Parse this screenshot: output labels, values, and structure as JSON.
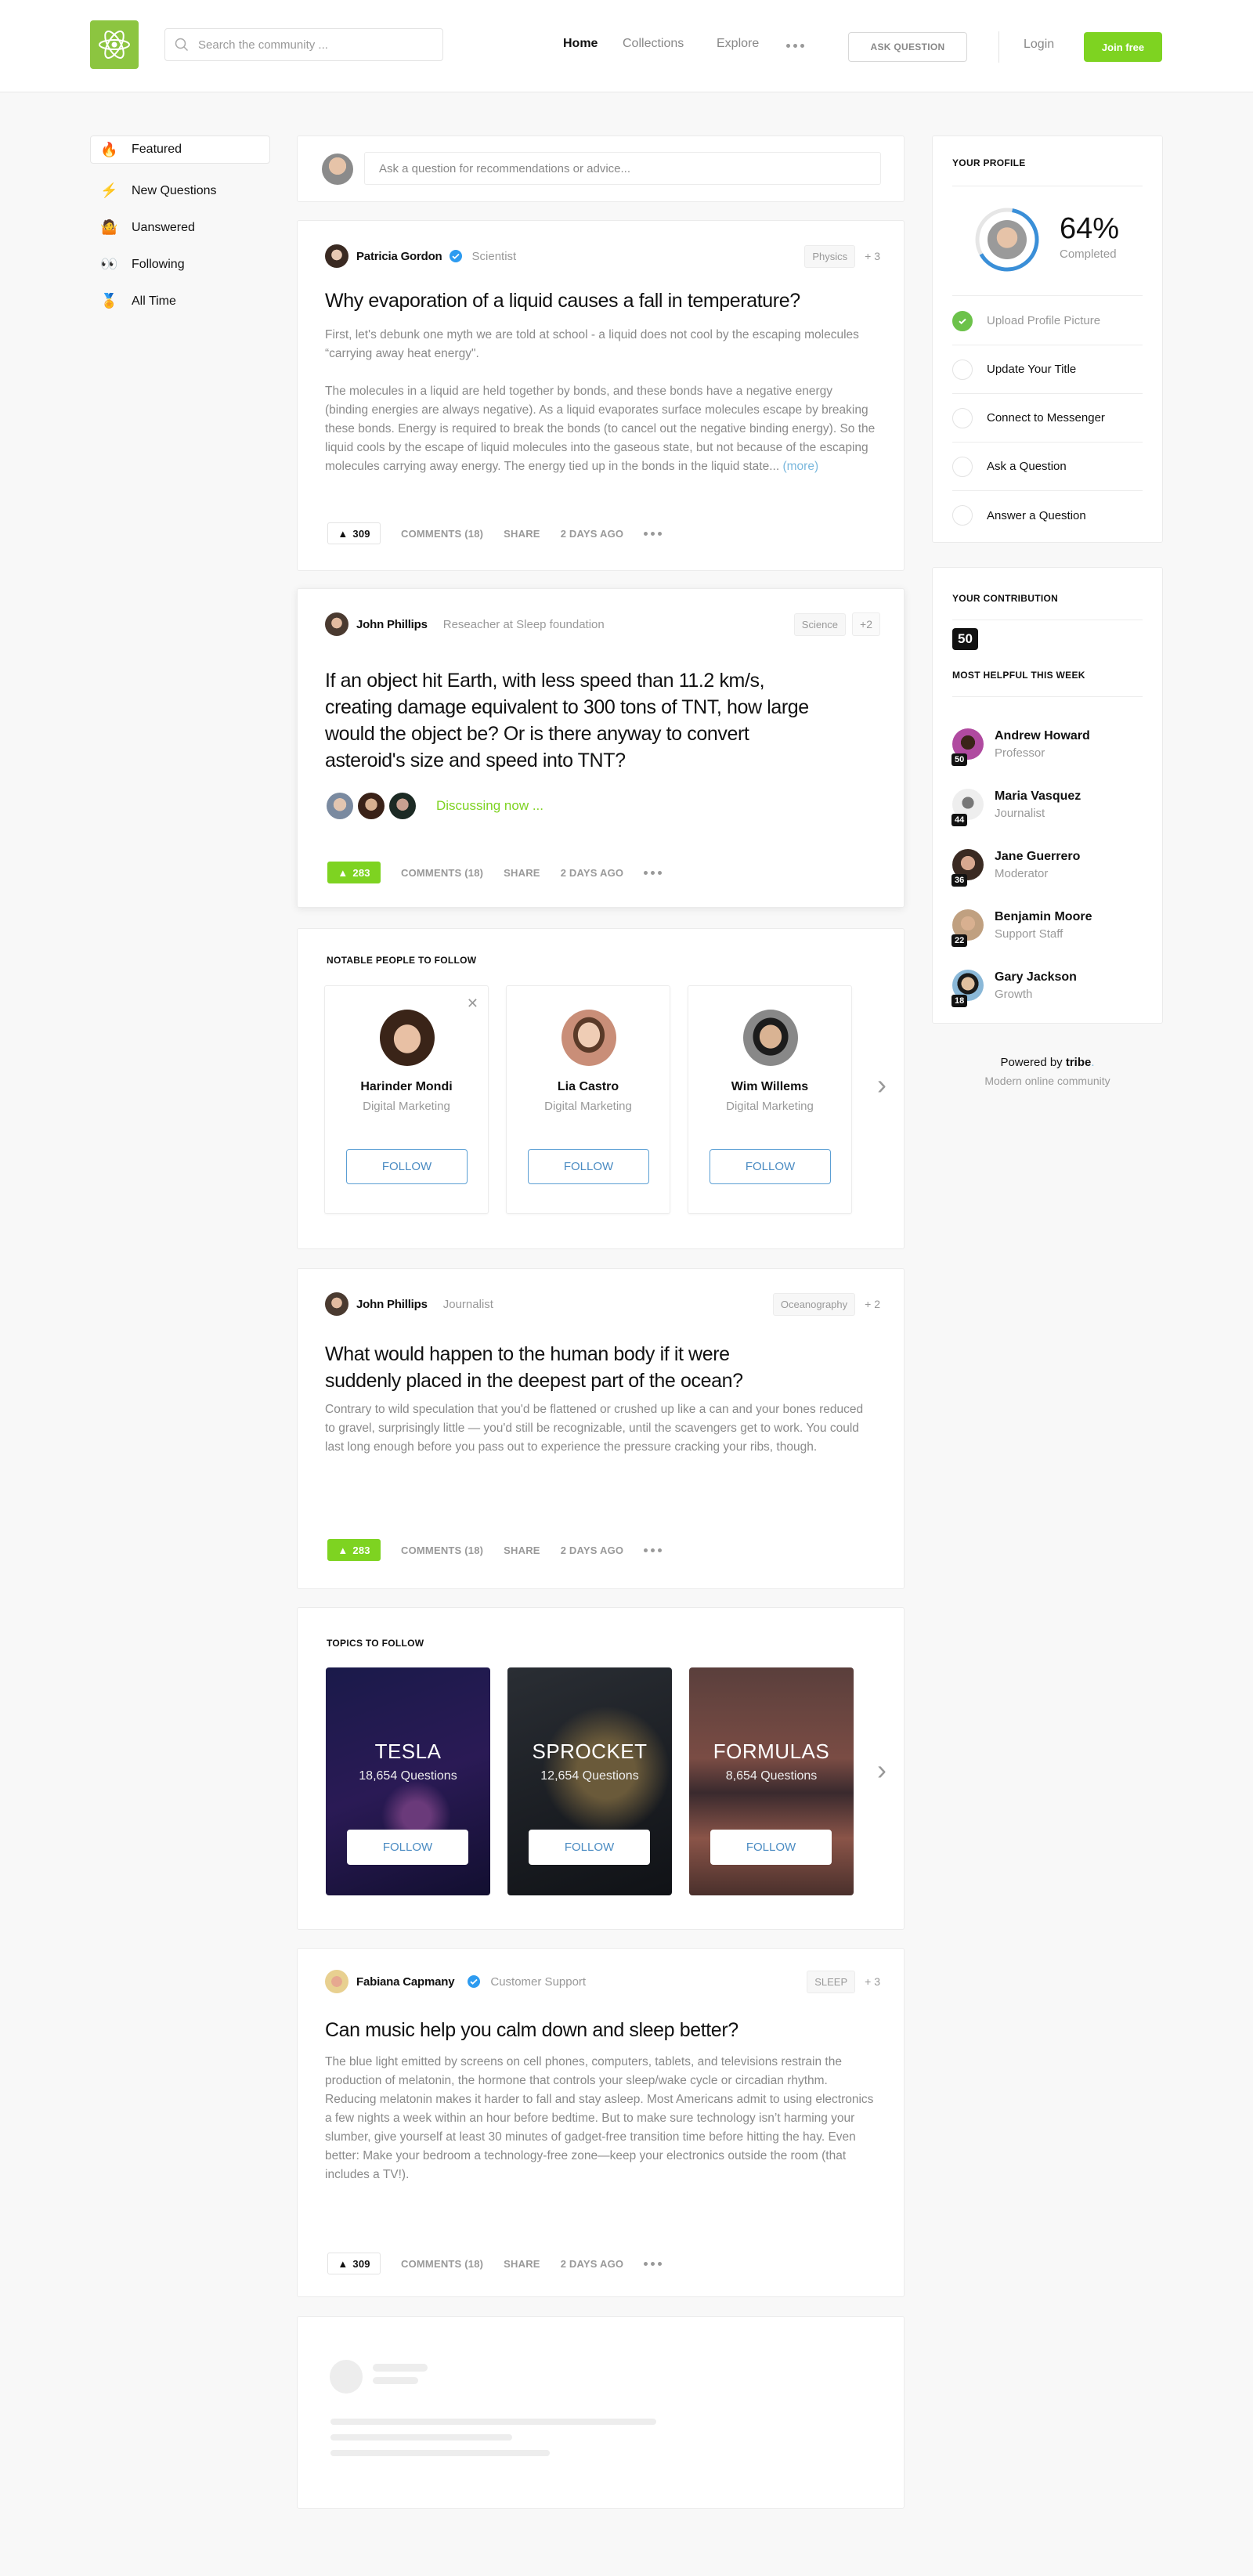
{
  "header": {
    "search_placeholder": "Search the community ...",
    "nav": [
      "Home",
      "Collections",
      "Explore"
    ],
    "ask_question": "ASK QUESTION",
    "login": "Login",
    "join": "Join free",
    "brand_color": "#7ed321"
  },
  "sidebar": {
    "items": [
      {
        "icon": "🔥",
        "label": "Featured"
      },
      {
        "icon": "⚡",
        "label": "New Questions"
      },
      {
        "icon": "🤷",
        "label": "Uanswered"
      },
      {
        "icon": "👀",
        "label": "Following"
      },
      {
        "icon": "🏅",
        "label": "All Time"
      }
    ]
  },
  "ask": {
    "placeholder": "Ask a question for recommendations or advice..."
  },
  "posts": [
    {
      "author": "Patricia Gordon",
      "verified": true,
      "role": "Scientist",
      "tag": "Physics",
      "tag_more": "+ 3",
      "title": "Why evaporation of a liquid causes a fall in temperature?",
      "body_p1": "First, let's debunk one myth we are told at school - a liquid does not cool by the escaping molecules “carrying away heat energy\".",
      "body_p2": "The molecules in a liquid are held together by bonds, and these bonds have a negative energy (binding energies are always negative). As a liquid evaporates surface molecules escape by breaking these bonds. Energy is required to break the bonds (to cancel out the negative binding energy). So the liquid cools by the escape of liquid molecules into the gaseous state, but not because of the escaping molecules carrying away energy. The energy tied up in the bonds in the liquid state...",
      "more": "(more)",
      "votes": "309",
      "comments": "COMMENTS (18)",
      "share": "SHARE",
      "time": "2 DAYS AGO"
    },
    {
      "author": "John Phillips",
      "verified": false,
      "role": "Reseacher at Sleep foundation",
      "tag": "Science",
      "tag_more": "+2",
      "title": "If an object hit Earth, with less speed than 11.2 km/s, creating damage equivalent to 300 tons of TNT, how large would the object be? Or is there anyway to convert asteroid's size and speed into TNT?",
      "discussing": "Discussing now ...",
      "votes": "283",
      "comments": "COMMENTS (18)",
      "share": "SHARE",
      "time": "2 DAYS AGO"
    },
    {
      "author": "John Phillips",
      "verified": false,
      "role": "Journalist",
      "tag": "Oceanography",
      "tag_more": "+ 2",
      "title": "What would happen to the human body if it were suddenly placed in the deepest part of the ocean?",
      "body_p1": "Contrary to wild speculation that you'd be flattened or crushed up like a can and your bones reduced to gravel, surprisingly little — you'd still be recognizable, until the scavengers get to work. You could last long enough before you pass out to experience the pressure cracking your ribs, though.",
      "votes": "283",
      "comments": "COMMENTS (18)",
      "share": "SHARE",
      "time": "2 DAYS AGO"
    },
    {
      "author": "Fabiana Capmany",
      "verified": true,
      "role": "Customer Support",
      "tag": "SLEEP",
      "tag_more": "+ 3",
      "title": "Can music help you calm down and sleep better?",
      "body_p1": "The blue light emitted by screens on cell phones, computers, tablets, and televisions restrain the production of melatonin, the hormone that controls your sleep/wake cycle or circadian rhythm. Reducing melatonin makes it harder to fall and stay asleep. Most Americans admit to using electronics a few nights a week within an hour before bedtime. But to make sure technology isn’t harming your slumber, give yourself at least 30 minutes of gadget-free transition time before hitting the hay. Even better: Make your bedroom a technology-free zone—keep your electronics outside the room (that includes a TV!).",
      "votes": "309",
      "comments": "COMMENTS (18)",
      "share": "SHARE",
      "time": "2 DAYS AGO"
    }
  ],
  "people": {
    "title": "NOTABLE PEOPLE TO FOLLOW",
    "follow": "FOLLOW",
    "items": [
      {
        "name": "Harinder Mondi",
        "role": "Digital Marketing"
      },
      {
        "name": "Lia Castro",
        "role": "Digital Marketing"
      },
      {
        "name": "Wim Willems",
        "role": "Digital Marketing"
      }
    ]
  },
  "topics": {
    "title": "TOPICS TO FOLLOW",
    "follow": "FOLLOW",
    "items": [
      {
        "name": "TESLA",
        "count": "18,654 Questions"
      },
      {
        "name": "SPROCKET",
        "count": "12,654 Questions"
      },
      {
        "name": "FORMULAS",
        "count": "8,654 Questions"
      }
    ]
  },
  "profile": {
    "title": "YOUR PROFILE",
    "percent": "64%",
    "progress": 0.64,
    "completed": "Completed",
    "tasks": [
      {
        "label": "Upload Profile Picture",
        "done": true
      },
      {
        "label": "Update Your Title",
        "done": false
      },
      {
        "label": "Connect to Messenger",
        "done": false
      },
      {
        "label": "Ask a Question",
        "done": false
      },
      {
        "label": "Answer a Question",
        "done": false
      }
    ]
  },
  "contribution": {
    "title": "YOUR CONTRIBUTION",
    "score": "50",
    "helpful_title": "MOST HELPFUL THIS WEEK",
    "helpers": [
      {
        "name": "Andrew Howard",
        "role": "Professor",
        "score": "50"
      },
      {
        "name": "Maria Vasquez",
        "role": "Journalist",
        "score": "44"
      },
      {
        "name": "Jane Guerrero",
        "role": "Moderator",
        "score": "36"
      },
      {
        "name": "Benjamin Moore",
        "role": "Support Staff",
        "score": "22"
      },
      {
        "name": "Gary Jackson",
        "role": "Growth",
        "score": "18"
      }
    ]
  },
  "footer": {
    "powered": "Powered by",
    "brand": "tribe",
    "dot": ".",
    "tagline": "Modern online community"
  }
}
